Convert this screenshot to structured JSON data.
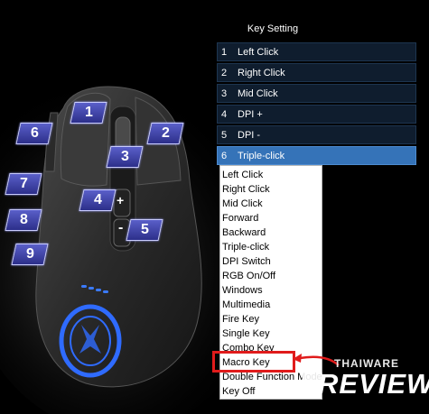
{
  "key_setting": {
    "title": "Key Setting",
    "rows": [
      {
        "num": "1",
        "label": "Left Click"
      },
      {
        "num": "2",
        "label": "Right Click"
      },
      {
        "num": "3",
        "label": "Mid Click"
      },
      {
        "num": "4",
        "label": "DPI +"
      },
      {
        "num": "5",
        "label": "DPI -"
      },
      {
        "num": "6",
        "label": "Triple-click"
      }
    ],
    "selected_row": "6"
  },
  "dropdown": {
    "options": [
      "Left Click",
      "Right Click",
      "Mid Click",
      "Forward",
      "Backward",
      "Triple-click",
      "DPI Switch",
      "RGB On/Off",
      "Windows",
      "Multimedia",
      "Fire Key",
      "Single Key",
      "Combo Key",
      "Macro Key",
      "Double Function Mode",
      "Key Off"
    ],
    "highlighted": "Macro Key"
  },
  "mouse_buttons": {
    "b1": "1",
    "b2": "2",
    "b3": "3",
    "b4": "4",
    "b5": "5",
    "b6": "6",
    "b7": "7",
    "b8": "8",
    "b9": "9",
    "plus_key": "+",
    "minus_key": "-"
  },
  "watermark": {
    "top": "THAIWARE",
    "main": "REVIEW"
  },
  "colors": {
    "selected_row": "#3573b8",
    "row_bg": "#0f1d2e",
    "badge": "#3b3fb0",
    "highlight": "#e01b1b",
    "mouse_led": "#2f6bff"
  }
}
